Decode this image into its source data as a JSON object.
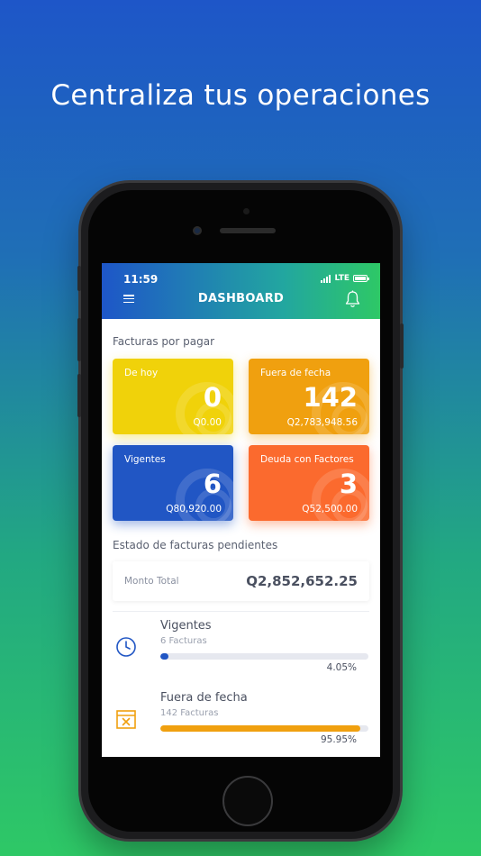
{
  "headline": "Centraliza tus operaciones",
  "status_bar": {
    "time": "11:59",
    "network": "LTE"
  },
  "header": {
    "title": "DASHBOARD",
    "menu_icon": "hamburger-menu-icon",
    "bell_icon": "bell-icon"
  },
  "facturas": {
    "title": "Facturas por pagar",
    "cards": [
      {
        "label": "De hoy",
        "count": "0",
        "amount": "Q0.00",
        "color": "#f0d20a"
      },
      {
        "label": "Fuera de fecha",
        "count": "142",
        "amount": "Q2,783,948.56",
        "color": "#f0a00f"
      },
      {
        "label": "Vigentes",
        "count": "6",
        "amount": "Q80,920.00",
        "color": "#2156c4"
      },
      {
        "label": "Deuda con Factores",
        "count": "3",
        "amount": "Q52,500.00",
        "color": "#fb6a2e"
      }
    ]
  },
  "estado": {
    "title": "Estado de facturas pendientes",
    "total_label": "Monto Total",
    "total_value": "Q2,852,652.25",
    "items": [
      {
        "name": "Vigentes",
        "sub": "6 Facturas",
        "percent": "4.05%",
        "fraction": 0.0405,
        "color": "#2156c4",
        "icon": "clock-icon"
      },
      {
        "name": "Fuera de fecha",
        "sub": "142 Facturas",
        "percent": "95.95%",
        "fraction": 0.9595,
        "color": "#f0a00f",
        "icon": "calendar-x-icon"
      }
    ]
  }
}
